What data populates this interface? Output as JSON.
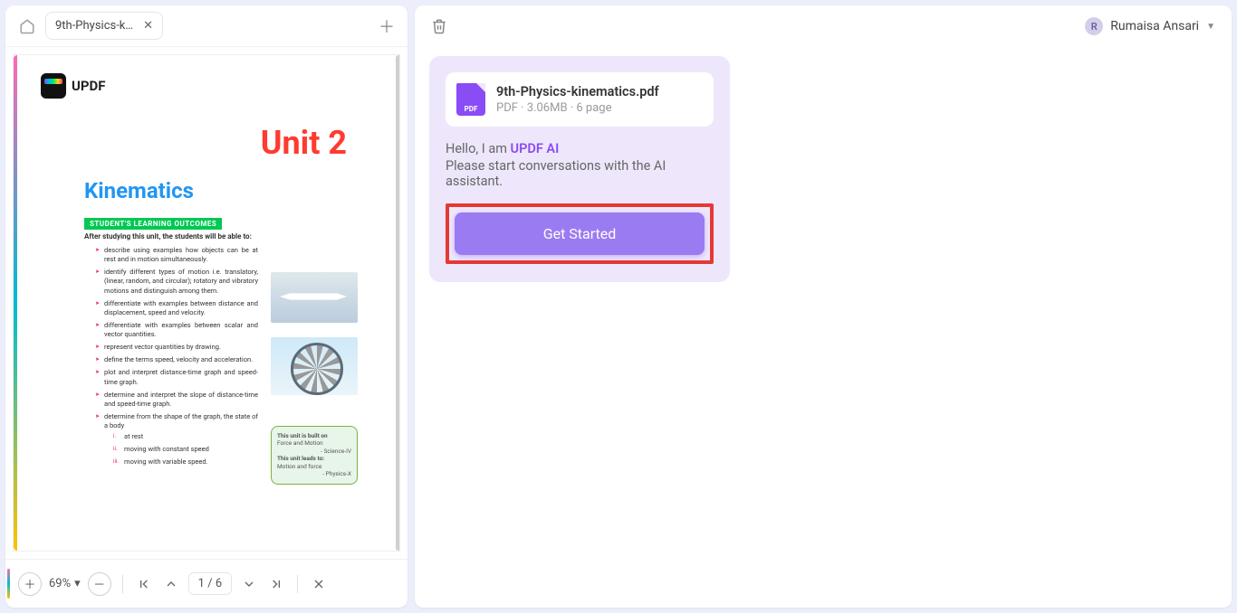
{
  "tab": {
    "title": "9th-Physics-ki..."
  },
  "doc": {
    "logo_text": "UPDF",
    "unit_title": "Unit 2",
    "chapter": "Kinematics",
    "learning_band": "STUDENT'S LEARNING OUTCOMES",
    "after_line": "After studying this unit, the students will be able to:",
    "bullets": [
      "describe using examples how objects can be at rest and in motion simultaneously.",
      "identify different types of motion i.e. translatory, (linear, random, and circular); rotatory and vibratory motions and distinguish among them.",
      "differentiate with examples between distance and displacement, speed and velocity.",
      "differentiate with examples between scalar and vector quantities.",
      "represent vector quantities by drawing.",
      "define the terms speed, velocity and acceleration.",
      "plot and interpret distance-time graph and speed-time graph.",
      "determine and interpret the slope of distance-time and speed-time graph.",
      "determine from the shape of the graph, the state of a body"
    ],
    "sub_bullets": [
      "at rest",
      "moving with constant speed",
      "moving with variable speed."
    ],
    "note": {
      "l1": "This unit is built on",
      "l2": "Force and Motion",
      "r1": "- Science-IV",
      "l3": "This unit leads to:",
      "l4": "Motion and force",
      "r2": "- Physics-X"
    }
  },
  "viewer": {
    "zoom": "69%",
    "page": "1",
    "pages": "6"
  },
  "ai": {
    "file_name": "9th-Physics-kinematics.pdf",
    "file_meta": "PDF · 3.06MB · 6 page",
    "hello": "Hello, I am ",
    "ai_name": "UPDF AI",
    "instruction": "Please start conversations with the AI assistant.",
    "button": "Get Started"
  },
  "user": {
    "initial": "R",
    "name": "Rumaisa Ansari"
  }
}
